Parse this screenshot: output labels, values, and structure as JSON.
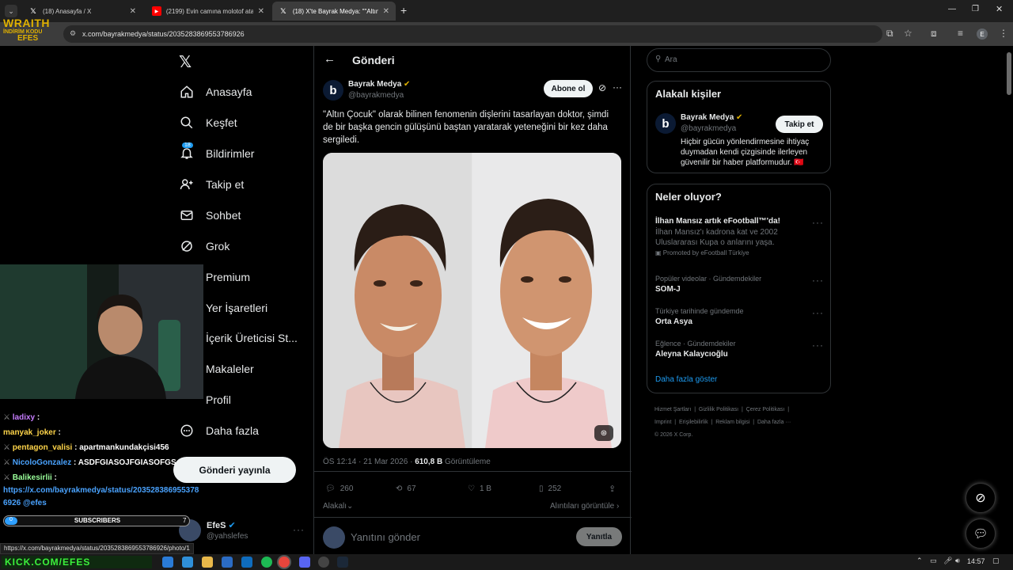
{
  "colors": {
    "accent": "#1d9bf0",
    "verified": "#1d9bf0",
    "gold": "#e0b100"
  },
  "browser": {
    "tabs": [
      {
        "label": "(18) Anasayfa / X",
        "icon": "x-icon"
      },
      {
        "label": "(2199) Evin camına molotof ata",
        "icon": "youtube-icon"
      },
      {
        "label": "(18) X'te Bayrak Medya: \"\"Altın",
        "icon": "x-icon"
      }
    ],
    "url": "x.com/bayrakmedya/status/2035283869553786926"
  },
  "nav": {
    "items": [
      {
        "label": "Anasayfa",
        "icon": "home-icon"
      },
      {
        "label": "Keşfet",
        "icon": "search-icon"
      },
      {
        "label": "Bildirimler",
        "icon": "bell-icon",
        "badge": "18"
      },
      {
        "label": "Takip et",
        "icon": "follow-icon"
      },
      {
        "label": "Sohbet",
        "icon": "mail-icon"
      },
      {
        "label": "Grok",
        "icon": "grok-icon"
      },
      {
        "label": "Premium",
        "icon": "premium-icon"
      },
      {
        "label": "Yer İşaretleri",
        "icon": "bookmark-icon"
      },
      {
        "label": "İçerik Üreticisi St...",
        "icon": "studio-icon"
      },
      {
        "label": "Makaleler",
        "icon": "article-icon"
      },
      {
        "label": "Profil",
        "icon": "profile-icon"
      },
      {
        "label": "Daha fazla",
        "icon": "more-icon"
      }
    ],
    "post_button": "Gönderi yayınla",
    "account": {
      "name": "EfeS",
      "handle": "@yahslefes"
    }
  },
  "post": {
    "header_title": "Gönderi",
    "author_name": "Bayrak Medya",
    "author_handle": "@bayrakmedya",
    "subscribe_label": "Abone ol",
    "text": "\"Altın Çocuk\" olarak bilinen fenomenin dişlerini tasarlayan doktor, şimdi de bir başka gencin gülüşünü baştan yaratarak yeteneğini bir kez daha sergiledi.",
    "time": "ÖS 12:14 · 21 Mar 2026 ·",
    "views_count": "610,8 B",
    "views_label": "Görüntüleme",
    "replies": "260",
    "reposts": "67",
    "likes": "1 B",
    "bookmarks": "252",
    "related_label": "Alakalı",
    "quotes_label": "Alıntıları görüntüle",
    "reply_placeholder": "Yanıtını gönder",
    "reply_button": "Yanıtla"
  },
  "right": {
    "search_placeholder": "Ara",
    "relevant": {
      "title": "Alakalı kişiler",
      "name": "Bayrak Medya",
      "handle": "@bayrakmedya",
      "follow_label": "Takip et",
      "bio": "Hiçbir gücün yönlendirmesine ihtiyaç duymadan kendi çizgisinde ilerleyen güvenilir bir haber platformudur. 🇹🇷"
    },
    "trends": {
      "title": "Neler oluyor?",
      "promo": {
        "title": "İlhan Mansız artık eFootball™'da!",
        "body": "İlhan Mansız'ı kadrona kat ve 2002 Uluslararası Kupa o anlarını yaşa.",
        "promoted": "Promoted by eFootball Türkiye"
      },
      "items": [
        {
          "meta": "Popüler videolar · Gündemdekiler",
          "title": "SOM-J"
        },
        {
          "meta": "Türkiye tarihinde gündemde",
          "title": "Orta Asya"
        },
        {
          "meta": "Eğlence · Gündemdekiler",
          "title": "Aleyna Kalaycıoğlu"
        }
      ],
      "show_more": "Daha fazla göster"
    },
    "footer_links": [
      "Hizmet Şartları",
      "|",
      "Gizlilik Politikası",
      "|",
      "Çerez Politikası",
      "|",
      "Imprint",
      "|",
      "Erişilebilirlik",
      "|",
      "Reklam bilgisi",
      "|",
      "Daha fazla ···"
    ],
    "copyright": "© 2026 X Corp."
  },
  "overlay": {
    "brand_top": "WRAITH",
    "brand_sub": "İNDİRİM KODU",
    "brand_name": "EFES",
    "chat": [
      {
        "user": "ladixy",
        "msg": "",
        "color": "#c77dff"
      },
      {
        "user": "manyak_joker",
        "msg": "",
        "color": "#ffd54a"
      },
      {
        "user": "pentagon_valisi",
        "msg": "apartmankundakçisi456",
        "color": "#ffd54a"
      },
      {
        "user": "NicoloGonzalez",
        "msg": "ASDFGIASOJFGIASOFGS",
        "color": "#4aa3ff"
      },
      {
        "user": "Balikesirlii",
        "msg": "",
        "color": "#9aff9a"
      }
    ],
    "link_line1": "https://x.com/bayrakmedya/status/203528386955378",
    "link_line2": "6926 @efes",
    "subs_label": "SUBSCRIBERS",
    "subs_left": "0",
    "subs_right": "7",
    "status_url": "https://x.com/bayrakmedya/status/2035283869553786926/photo/1",
    "bottom_banner": "KICK.COM/EFES"
  },
  "taskbar": {
    "time": "14:57"
  }
}
